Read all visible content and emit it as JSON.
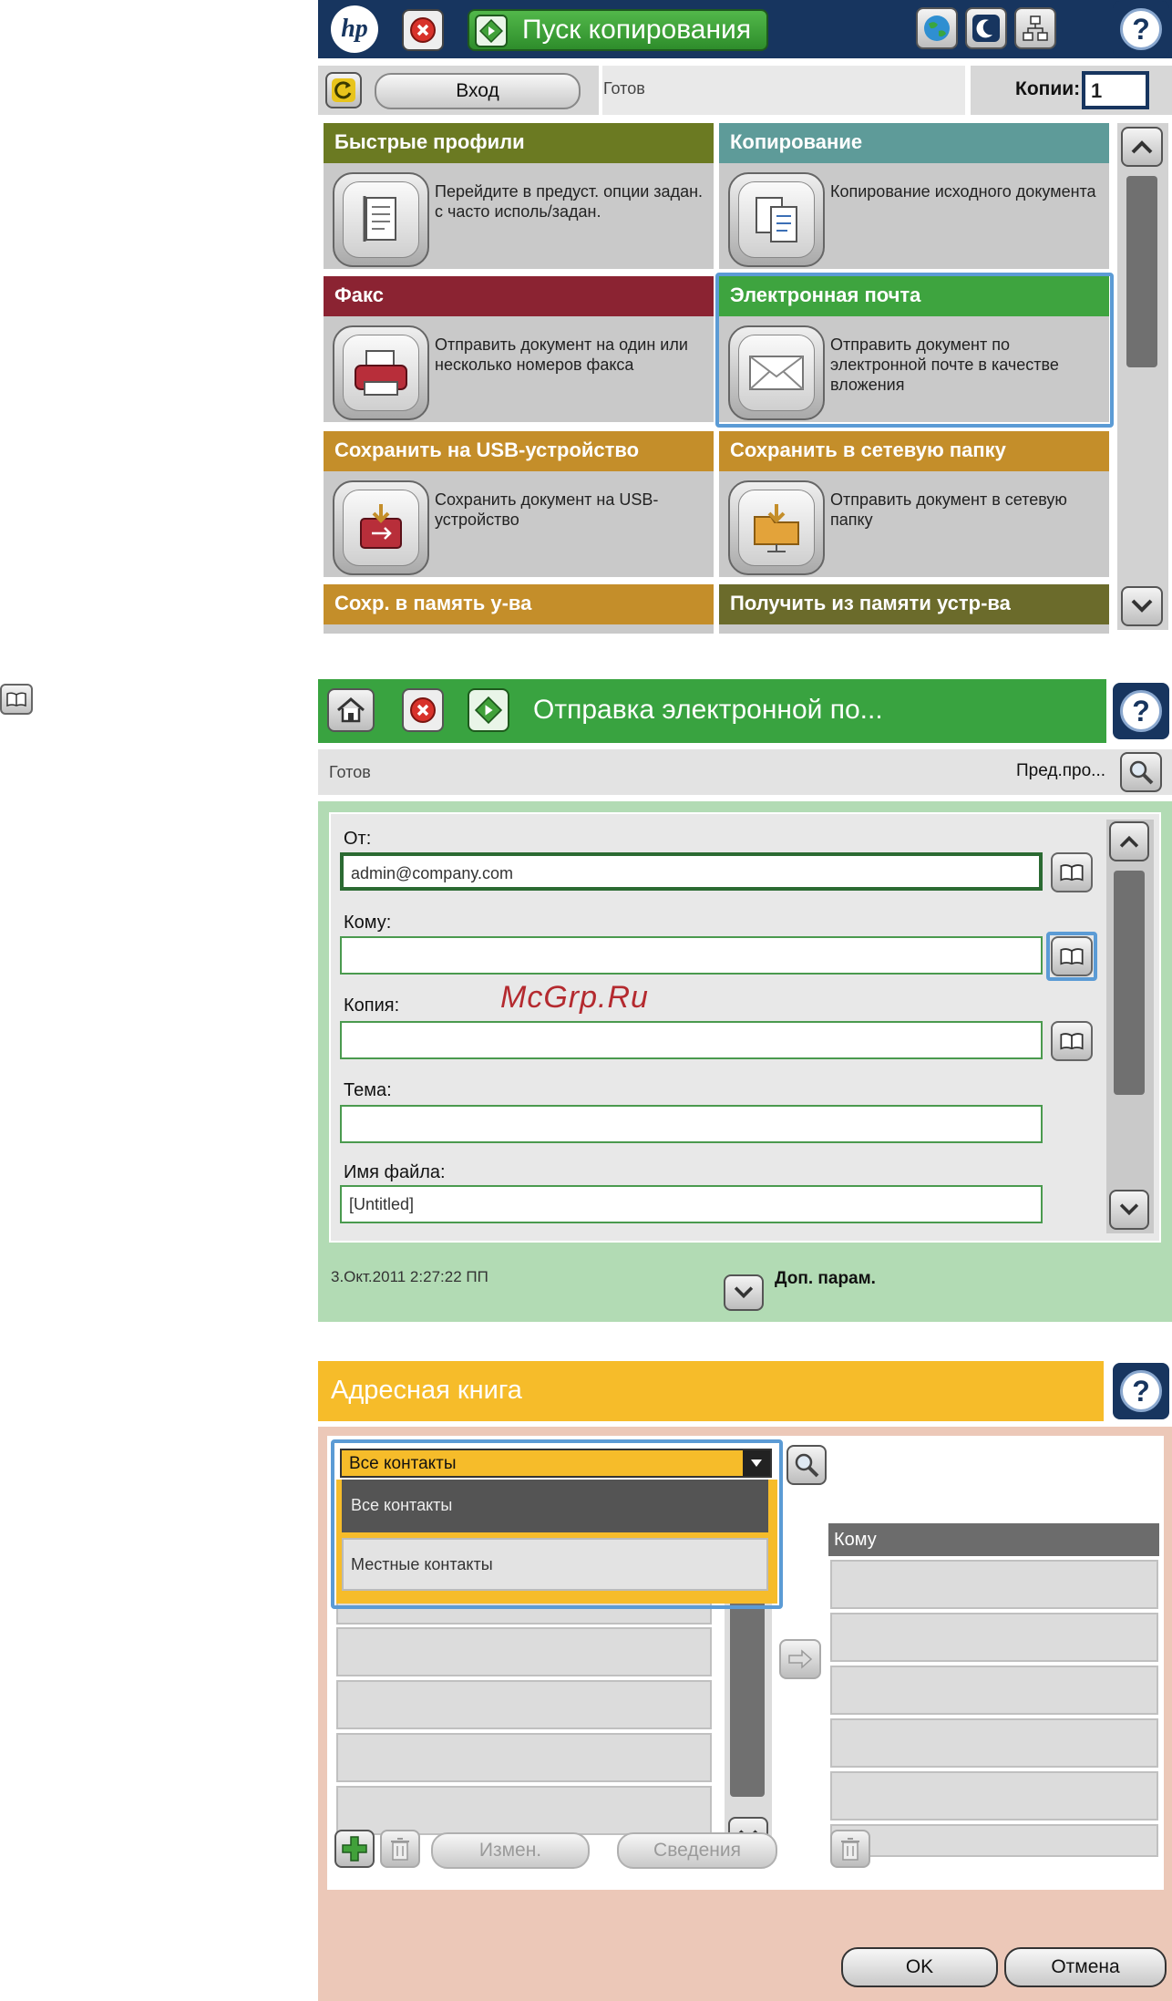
{
  "side_icon": "address-book-icon",
  "screen1": {
    "brand": "hp",
    "start_copy_label": "Пуск копирования",
    "login_label": "Вход",
    "status": "Готов",
    "copies_label": "Копии:",
    "copies_value": "1",
    "tiles": [
      {
        "title": "Быстрые профили",
        "desc": "Перейдите в предуст. опции задан. с часто исполь/задан.",
        "color": "#6b7a22"
      },
      {
        "title": "Копирование",
        "desc": "Копирование исходного документа",
        "color": "#5e9b99"
      },
      {
        "title": "Факс",
        "desc": "Отправить документ на один или несколько номеров факса",
        "color": "#8b2332"
      },
      {
        "title": "Электронная почта",
        "desc": "Отправить документ по электронной почте в качестве вложения",
        "color": "#3ea43f"
      },
      {
        "title": "Сохранить на USB-устройство",
        "desc": "Сохранить документ на USB-устройство",
        "color": "#c48e2a"
      },
      {
        "title": "Сохранить в сетевую папку",
        "desc": "Отправить документ в сетевую папку",
        "color": "#c48e2a"
      },
      {
        "title": "Сохр. в память у-ва",
        "desc": "",
        "color": "#c48e2a"
      },
      {
        "title": "Получить из памяти устр-ва",
        "desc": "",
        "color": "#6b6b2b"
      }
    ]
  },
  "screen2": {
    "title": "Отправка электронной по...",
    "status": "Готов",
    "preview_label": "Пред.про...",
    "fields": [
      {
        "label": "От:",
        "value": "admin@company.com"
      },
      {
        "label": "Кому:",
        "value": ""
      },
      {
        "label": "Копия:",
        "value": ""
      },
      {
        "label": "Тема:",
        "value": ""
      },
      {
        "label": "Имя файла:",
        "value": "[Untitled]"
      }
    ],
    "watermark": "McGrp.Ru",
    "datetime": "3.Окт.2011 2:27:22 ПП",
    "more_options_label": "Доп. парам."
  },
  "screen3": {
    "title": "Адресная книга",
    "dropdown_selected": "Все контакты",
    "dropdown_options": [
      "Все контакты",
      "Местные контакты"
    ],
    "to_header": "Кому",
    "edit_label": "Измен.",
    "details_label": "Сведения",
    "ok_label": "OK",
    "cancel_label": "Отмена"
  }
}
